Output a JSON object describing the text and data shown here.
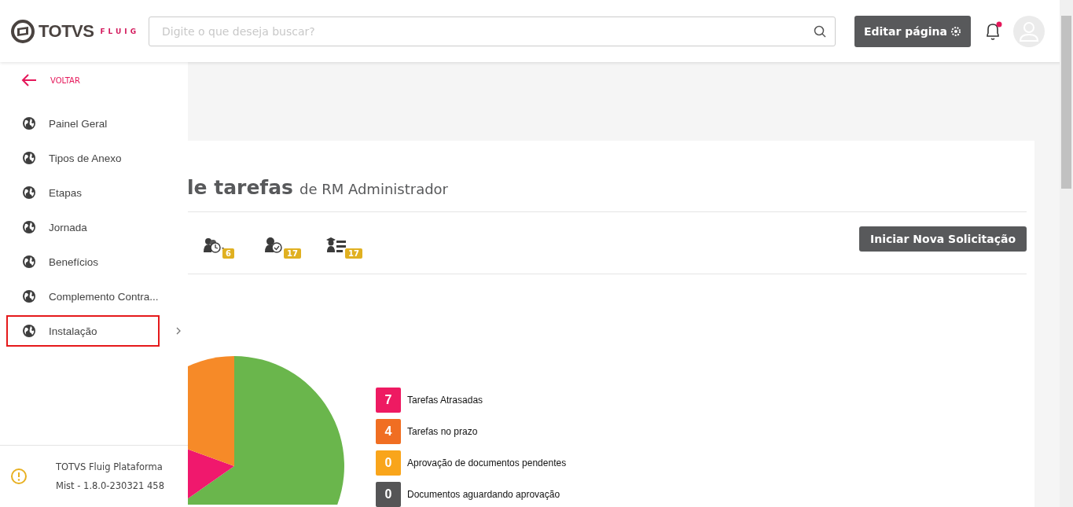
{
  "header": {
    "logo": "TOTVS",
    "logo_sub": "FLUIG",
    "search": {
      "placeholder": "Digite o que deseja buscar?"
    },
    "edit_button": "Editar página",
    "notification_unread": true
  },
  "sidebar": {
    "back": "VOLTAR",
    "items": [
      {
        "label": "Painel Geral",
        "highlighted": false,
        "has_children": false
      },
      {
        "label": "Tipos de Anexo",
        "highlighted": false,
        "has_children": false
      },
      {
        "label": "Etapas",
        "highlighted": false,
        "has_children": false
      },
      {
        "label": "Jornada",
        "highlighted": false,
        "has_children": false
      },
      {
        "label": "Benefícios",
        "highlighted": false,
        "has_children": false
      },
      {
        "label": "Complemento Contra...",
        "highlighted": false,
        "has_children": false
      },
      {
        "label": "Instalação",
        "highlighted": true,
        "has_children": true
      }
    ],
    "footer": {
      "product": "TOTVS Fluig Plataforma",
      "version": "Mist - 1.8.0-230321 458"
    }
  },
  "card": {
    "title": "le tarefas",
    "subtitle": "de RM Administrador",
    "task_icons": [
      {
        "kind": "group",
        "count": "6"
      },
      {
        "kind": "person",
        "count": "17"
      },
      {
        "kind": "student",
        "count": "17"
      }
    ],
    "new_request_button": "Iniciar Nova Solicitação",
    "legend": [
      {
        "count": "7",
        "label": "Tarefas Atrasadas",
        "color": "#ee1a62"
      },
      {
        "count": "4",
        "label": "Tarefas no prazo",
        "color": "#f06e22"
      },
      {
        "count": "0",
        "label": "Aprovação de documentos pendentes",
        "color": "#f9a51b"
      },
      {
        "count": "0",
        "label": "Documentos aguardando aprovação",
        "color": "#555556"
      }
    ]
  }
}
